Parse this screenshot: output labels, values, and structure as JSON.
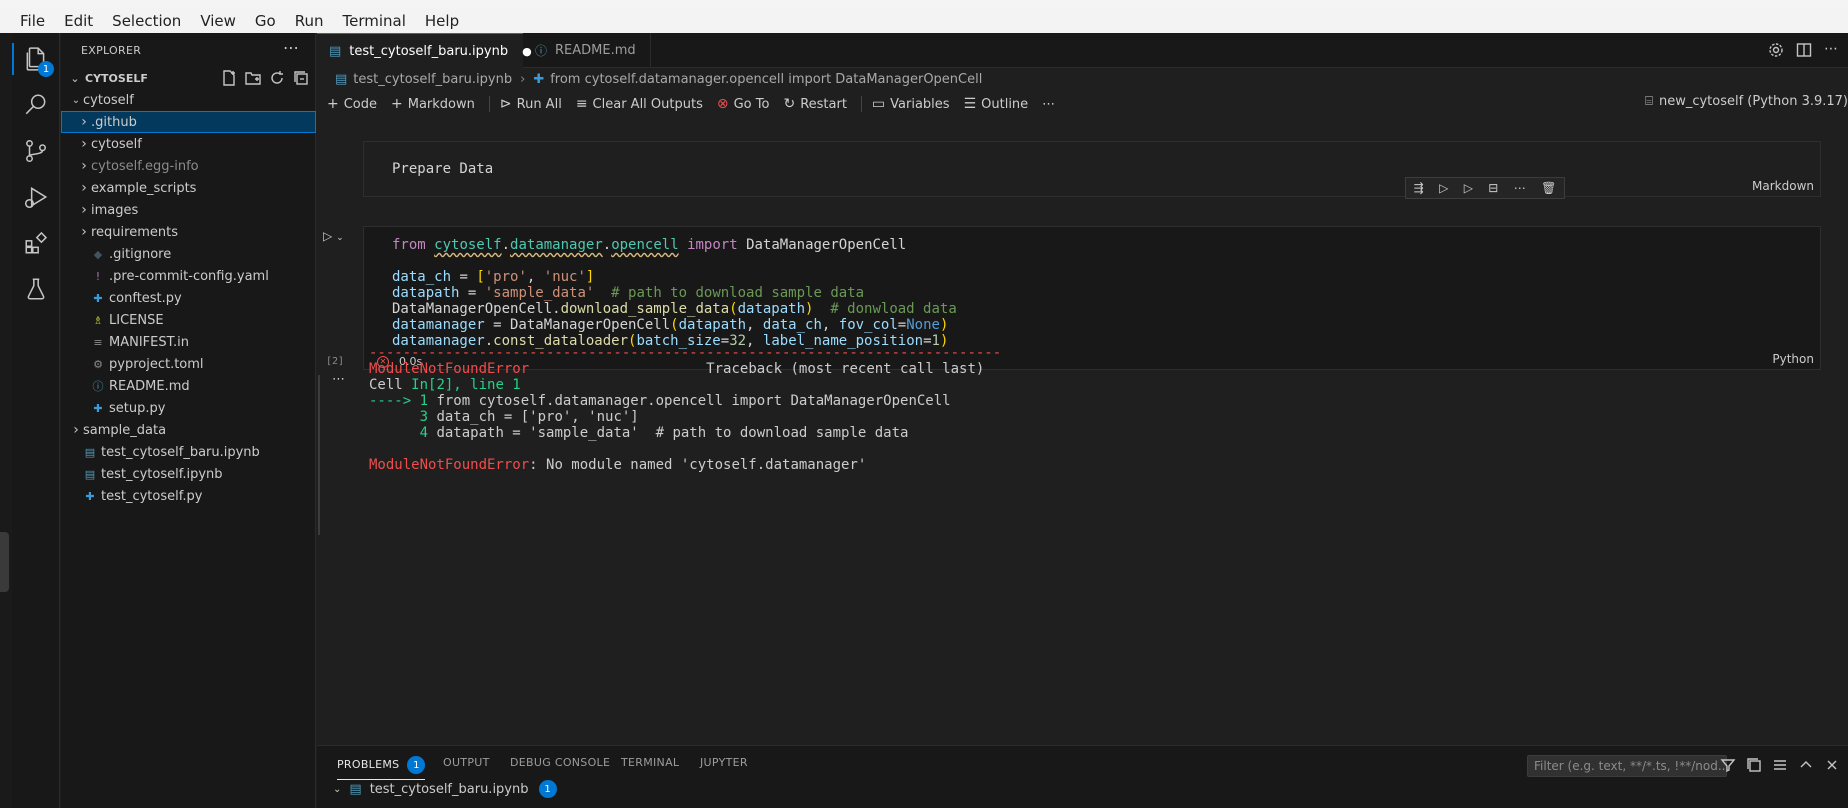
{
  "menu": [
    "File",
    "Edit",
    "Selection",
    "View",
    "Go",
    "Run",
    "Terminal",
    "Help"
  ],
  "activity": {
    "explorer_badge": "1",
    "icons": [
      "files-icon",
      "search-icon",
      "source-control-icon",
      "run-debug-icon",
      "extensions-icon",
      "testing-icon"
    ]
  },
  "sidebar": {
    "title": "EXPLORER",
    "more": "⋯",
    "section": "CYTOSELF",
    "items": [
      {
        "label": "cytoself",
        "type": "folder-open",
        "indent": 1
      },
      {
        "label": ".github",
        "type": "folder",
        "indent": 2,
        "selected": true
      },
      {
        "label": "cytoself",
        "type": "folder",
        "indent": 2
      },
      {
        "label": "cytoself.egg-info",
        "type": "folder",
        "indent": 2,
        "dim": true
      },
      {
        "label": "example_scripts",
        "type": "folder",
        "indent": 2
      },
      {
        "label": "images",
        "type": "folder",
        "indent": 2
      },
      {
        "label": "requirements",
        "type": "folder",
        "indent": 2
      },
      {
        "label": ".gitignore",
        "type": "file",
        "icon": "◆",
        "icolor": "#41535b",
        "indent": 2
      },
      {
        "label": ".pre-commit-config.yaml",
        "type": "file",
        "icon": "!",
        "icolor": "#a074c4",
        "indent": 2
      },
      {
        "label": "conftest.py",
        "type": "file",
        "icon": "✚",
        "icolor": "#3c9ad6",
        "indent": 2
      },
      {
        "label": "LICENSE",
        "type": "file",
        "icon": "♗",
        "icolor": "#cbcb41",
        "indent": 2
      },
      {
        "label": "MANIFEST.in",
        "type": "file",
        "icon": "≡",
        "icolor": "#8b8b8b",
        "indent": 2
      },
      {
        "label": "pyproject.toml",
        "type": "file",
        "icon": "⚙",
        "icolor": "#8b8b8b",
        "indent": 2
      },
      {
        "label": "README.md",
        "type": "file",
        "icon": "ⓘ",
        "icolor": "#519aba",
        "indent": 2
      },
      {
        "label": "setup.py",
        "type": "file",
        "icon": "✚",
        "icolor": "#3c9ad6",
        "indent": 2
      },
      {
        "label": "sample_data",
        "type": "folder",
        "indent": 1
      },
      {
        "label": "test_cytoself_baru.ipynb",
        "type": "file",
        "icon": "▤",
        "icolor": "#519aba",
        "indent": 1
      },
      {
        "label": "test_cytoself.ipynb",
        "type": "file",
        "icon": "▤",
        "icolor": "#519aba",
        "indent": 1
      },
      {
        "label": "test_cytoself.py",
        "type": "file",
        "icon": "✚",
        "icolor": "#3c9ad6",
        "indent": 1
      }
    ]
  },
  "tabs": [
    {
      "label": "test_cytoself_baru.ipynb",
      "active": true,
      "modified": "●"
    },
    {
      "label": "README.md",
      "active": false
    }
  ],
  "breadcrumb": {
    "file": "test_cytoself_baru.ipynb",
    "symbol": "from cytoself.datamanager.opencell import DataManagerOpenCell"
  },
  "toolbar": {
    "code": "Code",
    "markdown": "Markdown",
    "run_all": "Run All",
    "clear_outputs": "Clear All Outputs",
    "go_to": "Go To",
    "restart": "Restart",
    "variables": "Variables",
    "outline": "Outline",
    "more": "⋯",
    "kernel": "new_cytoself (Python 3.9.17)"
  },
  "md_cell": {
    "text": "Prepare Data",
    "lang": "Markdown"
  },
  "code_cell": {
    "exec_count": "[2]",
    "duration": "0.0s",
    "lang": "Python"
  },
  "output": {
    "dashes": "---------------------------------------------------------------------------",
    "err_name": "ModuleNotFoundError",
    "traceback": "Traceback (most recent call last)",
    "cell_prefix": "Cell ",
    "cell_in": "In[2], line 1",
    "arrow": "----> 1 ",
    "line1": "from cytoself.datamanager.opencell import DataManagerOpenCell",
    "ln3": "      3 ",
    "line3": "data_ch = ['pro', 'nuc']",
    "ln4": "      4 ",
    "line4": "datapath = 'sample_data'  # path to download sample data",
    "final_msg": ": No module named 'cytoself.datamanager'"
  },
  "panel": {
    "tabs": [
      "PROBLEMS",
      "OUTPUT",
      "DEBUG CONSOLE",
      "TERMINAL",
      "JUPYTER"
    ],
    "problems_count": "1",
    "filter_placeholder": "Filter (e.g. text, **/*.ts, !**/nod...",
    "problem_file": "test_cytoself_baru.ipynb",
    "problem_file_count": "1"
  }
}
